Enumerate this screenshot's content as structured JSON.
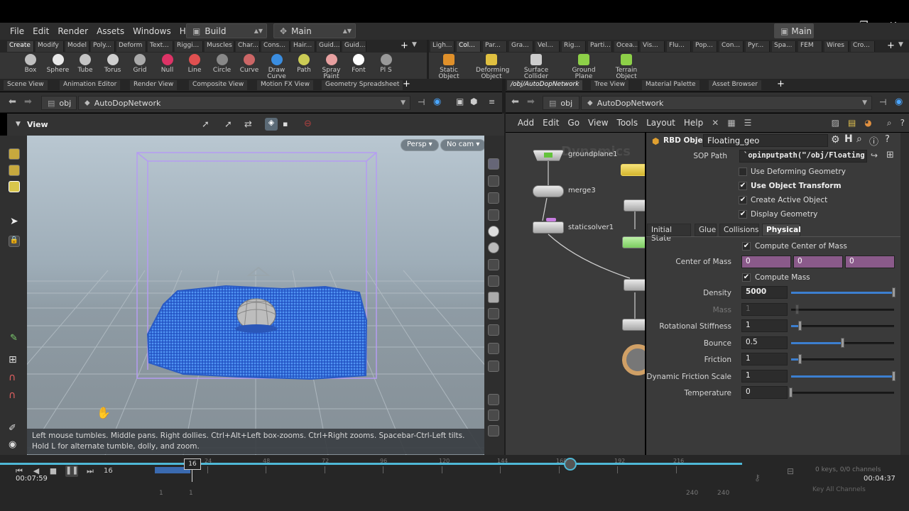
{
  "menubar": {
    "items": [
      "File",
      "Edit",
      "Render",
      "Assets",
      "Windows",
      "Help"
    ],
    "desktop_dropdown": "Build",
    "network_dropdown": "Main",
    "right_desktop": "Main"
  },
  "shelf_tabs_left": [
    "Create",
    "Modify",
    "Model",
    "Poly...",
    "Deform",
    "Text...",
    "Riggi...",
    "Muscles",
    "Char...",
    "Cons...",
    "Hair...",
    "Guid...",
    "Guid..."
  ],
  "shelf_tabs_right": [
    "Ligh...",
    "Col...",
    "Par...",
    "Gra...",
    "Vel...",
    "Rig...",
    "Parti...",
    "Ocea...",
    "Vis...",
    "Flu...",
    "Pop...",
    "Con...",
    "Pyr...",
    "Spa...",
    "FEM",
    "Wires",
    "Cro..."
  ],
  "shelf_tools_left": [
    "Box",
    "Sphere",
    "Tube",
    "Torus",
    "Grid",
    "Null",
    "Line",
    "Circle",
    "Curve",
    "Draw Curve",
    "Path",
    "Spray Paint",
    "Font",
    "Pl S"
  ],
  "shelf_tools_right": [
    "Static Object",
    "Deforming Object",
    "Surface Collider",
    "Ground Plane",
    "Terrain Object"
  ],
  "left_pane_tabs": [
    "Scene View",
    "Animation Editor",
    "Render View",
    "Composite View",
    "Motion FX View",
    "Geometry Spreadsheet"
  ],
  "right_pane_tabs": [
    "/obj/AutoDopNetwork",
    "Tree View",
    "Material Palette",
    "Asset Browser"
  ],
  "left_path": {
    "root": "obj",
    "node": "AutoDopNetwork"
  },
  "right_path": {
    "root": "obj",
    "node": "AutoDopNetwork"
  },
  "viewport": {
    "label": "View",
    "persp": "Persp",
    "cam": "No cam",
    "hint": "Left mouse tumbles. Middle pans. Right dollies. Ctrl+Alt+Left box-zooms. Ctrl+Right zooms. Spacebar-Ctrl-Left tilts. Hold L for alternate tumble, dolly, and zoom."
  },
  "network": {
    "menu": [
      "Add",
      "Edit",
      "Go",
      "View",
      "Tools",
      "Layout",
      "Help"
    ],
    "watermark": "Dynamics",
    "nodes": [
      "groundplane1",
      "merge3",
      "staticsolver1"
    ]
  },
  "parms": {
    "node_type": "RBD Object",
    "node_name": "Floating_geo",
    "sop_path_label": "SOP Path",
    "sop_path_value": "`opinputpath(\"/obj/Floating",
    "checks": [
      "Use Deforming Geometry",
      "Use Object Transform",
      "Create Active Object",
      "Display Geometry"
    ],
    "tabs": [
      "Initial State",
      "Glue",
      "Collisions",
      "Physical"
    ],
    "compute_com": "Compute Center of Mass",
    "com_label": "Center of Mass",
    "com_values": [
      "0",
      "0",
      "0"
    ],
    "compute_mass": "Compute Mass",
    "fields": [
      {
        "label": "Density",
        "value": "5000",
        "frac": 1.0
      },
      {
        "label": "Mass",
        "value": "1",
        "frac": 0.06
      },
      {
        "label": "Rotational Stiffness",
        "value": "1",
        "frac": 0.09
      },
      {
        "label": "Bounce",
        "value": "0.5",
        "frac": 0.5
      },
      {
        "label": "Friction",
        "value": "1",
        "frac": 0.09
      },
      {
        "label": "Dynamic Friction Scale",
        "value": "1",
        "frac": 1.0
      },
      {
        "label": "Temperature",
        "value": "0",
        "frac": 0.0
      }
    ]
  },
  "timeline": {
    "current_frame": "16",
    "frame_marker": "16",
    "elapsed": "00:07:59",
    "remaining": "00:04:37",
    "ticks": [
      "24",
      "48",
      "72",
      "96",
      "120",
      "144",
      "168",
      "192",
      "216"
    ],
    "keys_info": "0 keys, 0/0 channels",
    "key_all": "Key All Channels",
    "start1": "1",
    "start2": "1",
    "end1": "240",
    "end2": "240"
  }
}
